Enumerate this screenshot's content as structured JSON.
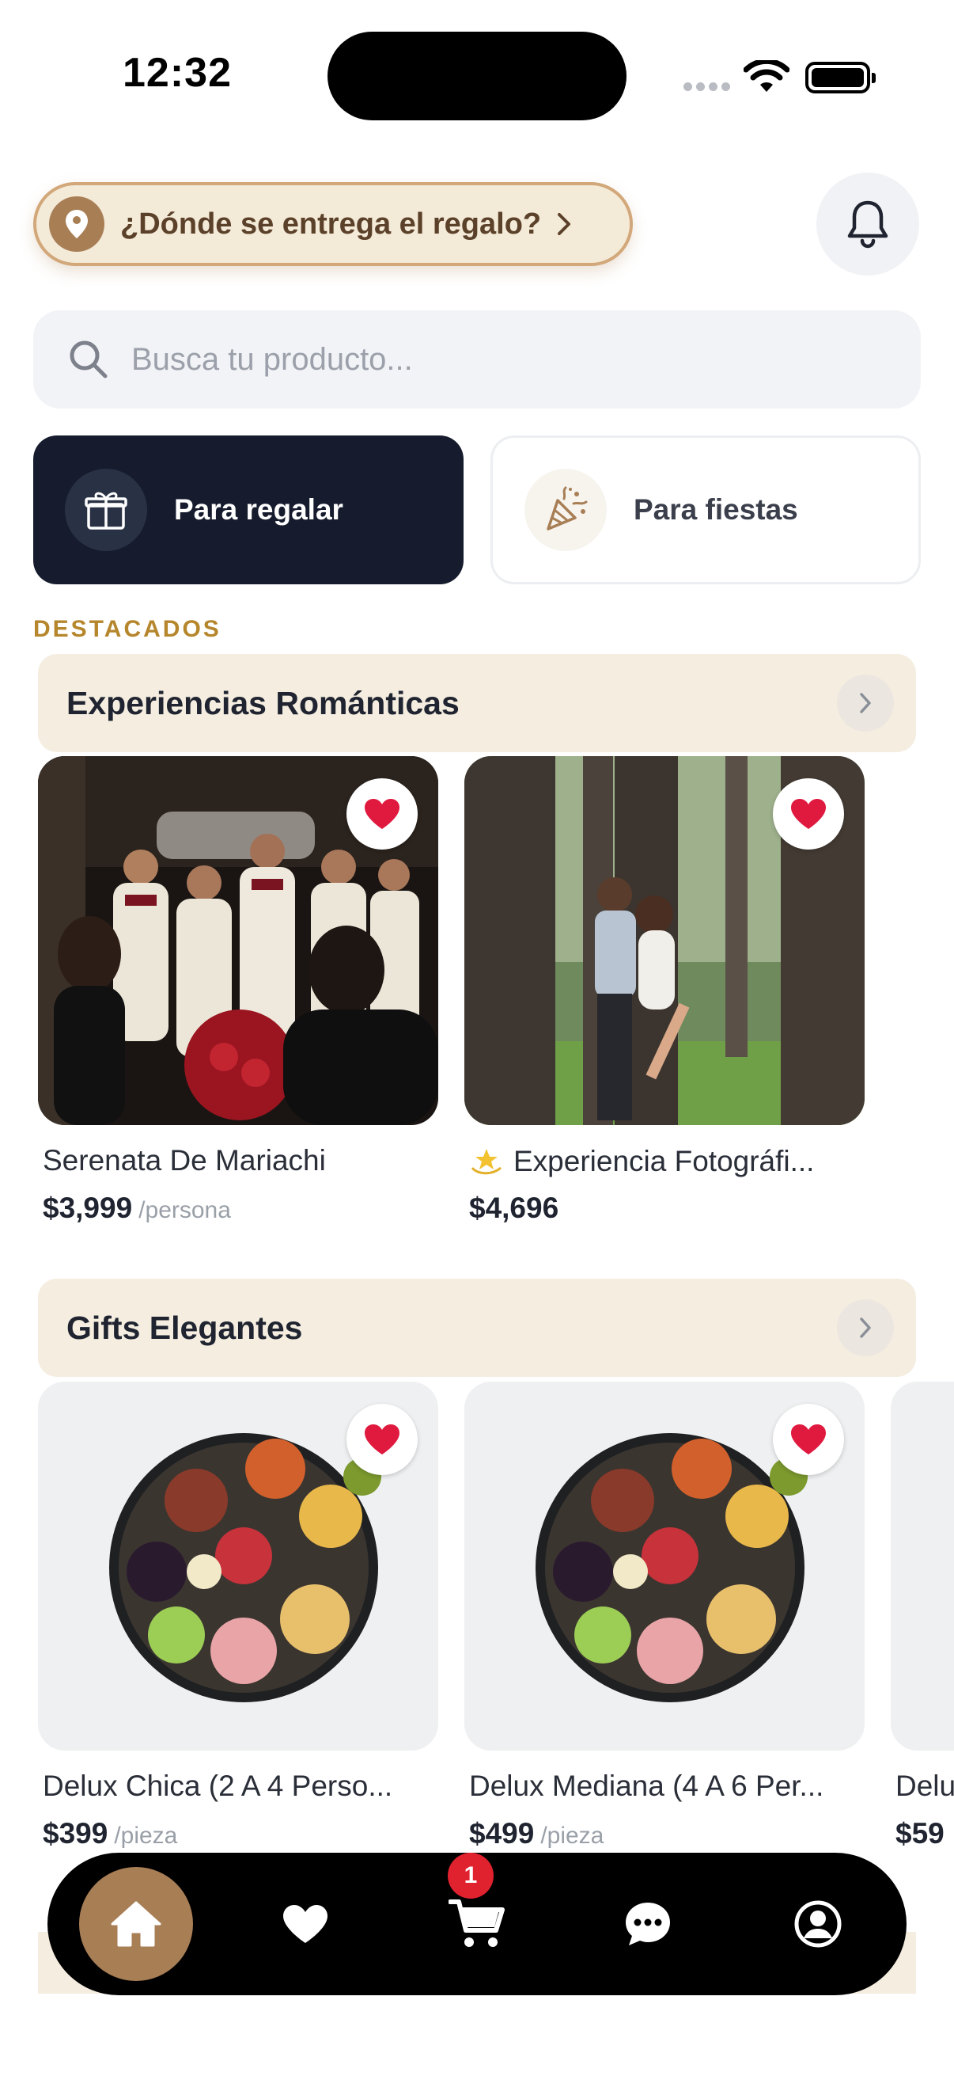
{
  "status_bar": {
    "time": "12:32"
  },
  "header": {
    "location_prompt": "¿Dónde se entrega el regalo?"
  },
  "search": {
    "placeholder": "Busca tu producto..."
  },
  "categories": [
    {
      "label": "Para regalar",
      "icon": "gift-icon",
      "selected": true
    },
    {
      "label": "Para fiestas",
      "icon": "party-popper-icon",
      "selected": false
    }
  ],
  "featured_label": "DESTACADOS",
  "sections": [
    {
      "title": "Experiencias Románticas",
      "products": [
        {
          "name": "Serenata De Mariachi",
          "price": "$3,999",
          "unit": "/persona"
        },
        {
          "name": "Experiencia Fotográfi...",
          "price": "$4,696",
          "unit": ""
        }
      ]
    },
    {
      "title": "Gifts Elegantes",
      "products": [
        {
          "name": "Delux Chica (2 A 4 Perso...",
          "price": "$399",
          "unit": "/pieza"
        },
        {
          "name": "Delux Mediana (4 A 6 Per...",
          "price": "$499",
          "unit": "/pieza"
        },
        {
          "name": "Delu",
          "price": "$59",
          "unit": ""
        }
      ]
    }
  ],
  "nav": {
    "items": [
      "home-icon",
      "heart-icon",
      "cart-icon",
      "chat-icon",
      "profile-icon"
    ],
    "cart_count": "1"
  },
  "colors": {
    "accent_brown": "#a87e55",
    "dark_navy": "#161c2e",
    "heart_red": "#e0193f",
    "section_bg": "#f4ede0",
    "featured_gold": "#b5862c"
  }
}
